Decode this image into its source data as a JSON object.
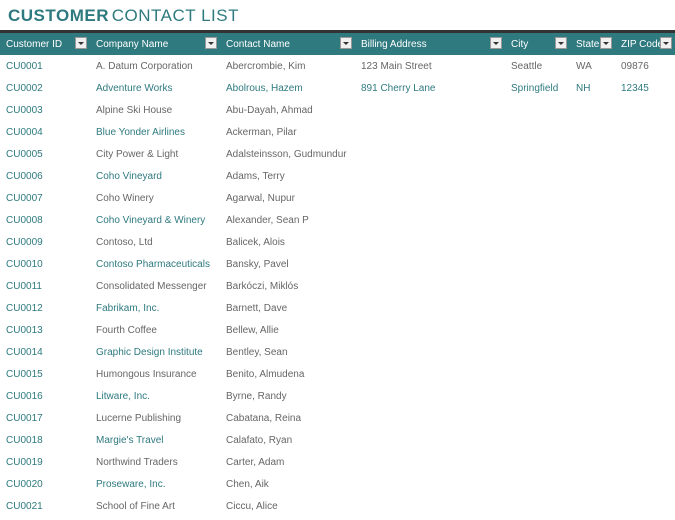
{
  "title": {
    "bold": "CUSTOMER",
    "rest": "CONTACT LIST"
  },
  "columns": [
    {
      "label": "Customer ID"
    },
    {
      "label": "Company Name"
    },
    {
      "label": "Contact Name"
    },
    {
      "label": "Billing Address"
    },
    {
      "label": "City"
    },
    {
      "label": "State"
    },
    {
      "label": "ZIP Code"
    }
  ],
  "rows": [
    {
      "id": "CU0001",
      "company": "A. Datum Corporation",
      "contact": "Abercrombie, Kim",
      "billing": "123 Main Street",
      "city": "Seattle",
      "state": "WA",
      "zip": "09876",
      "company_link": false
    },
    {
      "id": "CU0002",
      "company": "Adventure Works",
      "contact": "Abolrous, Hazem",
      "billing": "891 Cherry Lane",
      "city": "Springfield",
      "state": "NH",
      "zip": "12345",
      "company_link": true,
      "row_link": true
    },
    {
      "id": "CU0003",
      "company": "Alpine Ski House",
      "contact": "Abu-Dayah, Ahmad",
      "billing": "",
      "city": "",
      "state": "",
      "zip": "",
      "company_link": false
    },
    {
      "id": "CU0004",
      "company": "Blue Yonder Airlines",
      "contact": "Ackerman, Pilar",
      "billing": "",
      "city": "",
      "state": "",
      "zip": "",
      "company_link": true
    },
    {
      "id": "CU0005",
      "company": "City Power & Light",
      "contact": "Adalsteinsson, Gudmundur",
      "billing": "",
      "city": "",
      "state": "",
      "zip": "",
      "company_link": false
    },
    {
      "id": "CU0006",
      "company": "Coho Vineyard",
      "contact": "Adams, Terry",
      "billing": "",
      "city": "",
      "state": "",
      "zip": "",
      "company_link": true
    },
    {
      "id": "CU0007",
      "company": "Coho Winery",
      "contact": "Agarwal, Nupur",
      "billing": "",
      "city": "",
      "state": "",
      "zip": "",
      "company_link": false
    },
    {
      "id": "CU0008",
      "company": "Coho Vineyard & Winery",
      "contact": "Alexander, Sean P",
      "billing": "",
      "city": "",
      "state": "",
      "zip": "",
      "company_link": true
    },
    {
      "id": "CU0009",
      "company": "Contoso, Ltd",
      "contact": "Balicek, Alois",
      "billing": "",
      "city": "",
      "state": "",
      "zip": "",
      "company_link": false
    },
    {
      "id": "CU0010",
      "company": "Contoso Pharmaceuticals",
      "contact": "Bansky, Pavel",
      "billing": "",
      "city": "",
      "state": "",
      "zip": "",
      "company_link": true
    },
    {
      "id": "CU0011",
      "company": "Consolidated Messenger",
      "contact": "Barkóczi, Miklós",
      "billing": "",
      "city": "",
      "state": "",
      "zip": "",
      "company_link": false
    },
    {
      "id": "CU0012",
      "company": "Fabrikam, Inc.",
      "contact": "Barnett, Dave",
      "billing": "",
      "city": "",
      "state": "",
      "zip": "",
      "company_link": true
    },
    {
      "id": "CU0013",
      "company": "Fourth Coffee",
      "contact": "Bellew, Allie",
      "billing": "",
      "city": "",
      "state": "",
      "zip": "",
      "company_link": false
    },
    {
      "id": "CU0014",
      "company": "Graphic Design Institute",
      "contact": "Bentley, Sean",
      "billing": "",
      "city": "",
      "state": "",
      "zip": "",
      "company_link": true
    },
    {
      "id": "CU0015",
      "company": "Humongous Insurance",
      "contact": "Benito, Almudena",
      "billing": "",
      "city": "",
      "state": "",
      "zip": "",
      "company_link": false
    },
    {
      "id": "CU0016",
      "company": "Litware, Inc.",
      "contact": "Byrne, Randy",
      "billing": "",
      "city": "",
      "state": "",
      "zip": "",
      "company_link": true
    },
    {
      "id": "CU0017",
      "company": "Lucerne Publishing",
      "contact": "Cabatana, Reina",
      "billing": "",
      "city": "",
      "state": "",
      "zip": "",
      "company_link": false
    },
    {
      "id": "CU0018",
      "company": "Margie's Travel",
      "contact": "Calafato, Ryan",
      "billing": "",
      "city": "",
      "state": "",
      "zip": "",
      "company_link": true
    },
    {
      "id": "CU0019",
      "company": "Northwind Traders",
      "contact": "Carter, Adam",
      "billing": "",
      "city": "",
      "state": "",
      "zip": "",
      "company_link": false
    },
    {
      "id": "CU0020",
      "company": "Proseware, Inc.",
      "contact": "Chen, Aik",
      "billing": "",
      "city": "",
      "state": "",
      "zip": "",
      "company_link": true
    },
    {
      "id": "CU0021",
      "company": "School of Fine Art",
      "contact": "Ciccu, Alice",
      "billing": "",
      "city": "",
      "state": "",
      "zip": "",
      "company_link": false
    }
  ]
}
